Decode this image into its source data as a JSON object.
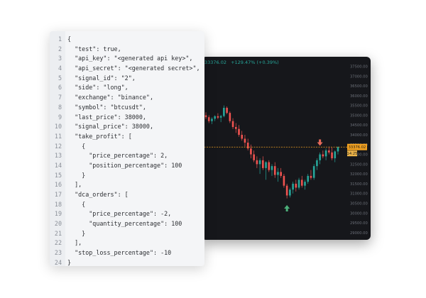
{
  "chart": {
    "header_price": "33376.02",
    "header_change": "+129.47% (+0.39%)",
    "current_price_tag": "33376.02",
    "countdown_tag": "14:25",
    "y_axis_labels": [
      "37500.00",
      "37000.00",
      "36500.00",
      "36000.00",
      "35500.00",
      "35000.00",
      "34500.00",
      "34000.00",
      "33500.00",
      "33000.00",
      "32500.00",
      "32000.00",
      "31500.00",
      "31000.00",
      "30500.00",
      "30000.00",
      "29500.00",
      "29000.00"
    ],
    "colors": {
      "up": "#26a69a",
      "down": "#ef5350",
      "background": "#16171b",
      "price_line": "#f0a020",
      "buy_arrow": "#4caf7a",
      "sell_arrow": "#e86a5a"
    }
  },
  "chart_data": {
    "type": "candlestick",
    "y_ticks": [
      37500,
      37000,
      36500,
      36000,
      35500,
      35000,
      34500,
      34000,
      33500,
      33000,
      32500,
      32000,
      31500,
      31000,
      30500,
      30000,
      29500,
      29000
    ],
    "ylim": [
      28850,
      37700
    ],
    "current_price": 33376.02,
    "candles": [
      {
        "o": 35000,
        "h": 35150,
        "l": 34800,
        "c": 34900
      },
      {
        "o": 34900,
        "h": 35000,
        "l": 34600,
        "c": 34700
      },
      {
        "o": 34700,
        "h": 34900,
        "l": 34550,
        "c": 34820
      },
      {
        "o": 34820,
        "h": 35000,
        "l": 34700,
        "c": 34950
      },
      {
        "o": 34950,
        "h": 35100,
        "l": 34800,
        "c": 34880
      },
      {
        "o": 34880,
        "h": 35020,
        "l": 34650,
        "c": 34960
      },
      {
        "o": 34960,
        "h": 35500,
        "l": 34900,
        "c": 35380
      },
      {
        "o": 35380,
        "h": 35450,
        "l": 35050,
        "c": 35120
      },
      {
        "o": 35120,
        "h": 35200,
        "l": 34600,
        "c": 34700
      },
      {
        "o": 34700,
        "h": 34850,
        "l": 34300,
        "c": 34400
      },
      {
        "o": 34400,
        "h": 34600,
        "l": 34100,
        "c": 34300
      },
      {
        "o": 34300,
        "h": 34500,
        "l": 33900,
        "c": 34000
      },
      {
        "o": 34000,
        "h": 34200,
        "l": 33700,
        "c": 33800
      },
      {
        "o": 33800,
        "h": 34000,
        "l": 33400,
        "c": 33600
      },
      {
        "o": 33600,
        "h": 33800,
        "l": 33200,
        "c": 33300
      },
      {
        "o": 33300,
        "h": 33500,
        "l": 32800,
        "c": 33000
      },
      {
        "o": 33000,
        "h": 33200,
        "l": 32600,
        "c": 32700
      },
      {
        "o": 32700,
        "h": 32900,
        "l": 32300,
        "c": 32500
      },
      {
        "o": 32500,
        "h": 32800,
        "l": 32000,
        "c": 32700
      },
      {
        "o": 32700,
        "h": 32900,
        "l": 32200,
        "c": 32300
      },
      {
        "o": 32300,
        "h": 32650,
        "l": 31700,
        "c": 32600
      },
      {
        "o": 32600,
        "h": 32700,
        "l": 32100,
        "c": 32200
      },
      {
        "o": 32200,
        "h": 32500,
        "l": 31900,
        "c": 32400
      },
      {
        "o": 32400,
        "h": 32600,
        "l": 31800,
        "c": 31950
      },
      {
        "o": 31950,
        "h": 32300,
        "l": 31600,
        "c": 32100
      },
      {
        "o": 32100,
        "h": 32300,
        "l": 31800,
        "c": 31900
      },
      {
        "o": 31900,
        "h": 32000,
        "l": 31300,
        "c": 31400
      },
      {
        "o": 31400,
        "h": 31500,
        "l": 30750,
        "c": 30900
      },
      {
        "o": 30900,
        "h": 31300,
        "l": 30800,
        "c": 31200
      },
      {
        "o": 31200,
        "h": 31600,
        "l": 31000,
        "c": 31500
      },
      {
        "o": 31500,
        "h": 31700,
        "l": 31100,
        "c": 31300
      },
      {
        "o": 31300,
        "h": 31800,
        "l": 31200,
        "c": 31700
      },
      {
        "o": 31700,
        "h": 31900,
        "l": 31300,
        "c": 31400
      },
      {
        "o": 31400,
        "h": 31700,
        "l": 31200,
        "c": 31600
      },
      {
        "o": 31600,
        "h": 32000,
        "l": 31500,
        "c": 31900
      },
      {
        "o": 31900,
        "h": 32200,
        "l": 31700,
        "c": 31800
      },
      {
        "o": 31800,
        "h": 32500,
        "l": 31700,
        "c": 32400
      },
      {
        "o": 32400,
        "h": 32800,
        "l": 32200,
        "c": 32700
      },
      {
        "o": 32700,
        "h": 33100,
        "l": 32500,
        "c": 33000
      },
      {
        "o": 33000,
        "h": 33200,
        "l": 32800,
        "c": 32900
      },
      {
        "o": 32900,
        "h": 33300,
        "l": 32700,
        "c": 33200
      },
      {
        "o": 33200,
        "h": 33400,
        "l": 33000,
        "c": 33100
      },
      {
        "o": 33100,
        "h": 33350,
        "l": 32700,
        "c": 32800
      },
      {
        "o": 32800,
        "h": 33200,
        "l": 32600,
        "c": 33150
      },
      {
        "o": 33150,
        "h": 33400,
        "l": 33000,
        "c": 33376
      }
    ],
    "markers": [
      {
        "type": "buy",
        "index": 27,
        "price": 30700
      },
      {
        "type": "sell",
        "index": 38,
        "price": 33150
      }
    ]
  },
  "code": {
    "lines": [
      "{",
      "  \"test\": true,",
      "  \"api_key\": \"<generated api key>\",",
      "  \"api_secret\": \"<generated secret>\",",
      "  \"signal_id\": \"2\",",
      "  \"side\": \"long\",",
      "  \"exchange\": \"binance\",",
      "  \"symbol\": \"btcusdt\",",
      "  \"last_price\": 38000,",
      "  \"signal_price\": 38000,",
      "  \"take_profit\": [",
      "    {",
      "      \"price_percentage\": 2,",
      "      \"position_percentage\": 100",
      "    }",
      "  ],",
      "  \"dca_orders\": [",
      "    {",
      "      \"price_percentage\": -2,",
      "      \"quantity_percentage\": 100",
      "    }",
      "  ],",
      "  \"stop_loss_percentage\": -10",
      "}"
    ]
  }
}
